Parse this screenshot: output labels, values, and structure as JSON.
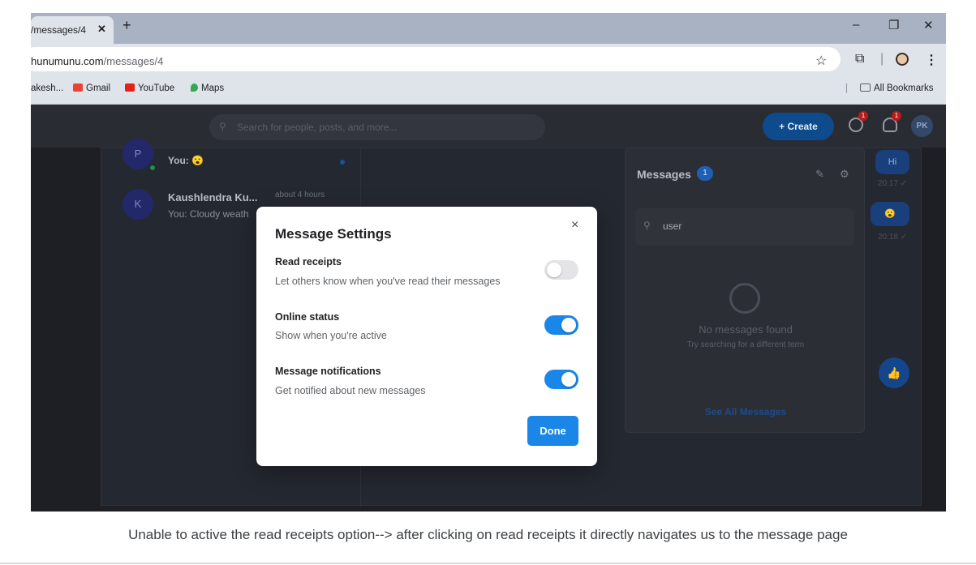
{
  "browser": {
    "tab_title": "/messages/4",
    "tab_close": "✕",
    "new_tab": "+",
    "window": {
      "minimize": "–",
      "restore": "❐",
      "close": "✕"
    },
    "url_host": "hunumunu.com",
    "url_path": "/messages/4",
    "bookmarks": [
      {
        "label": "akesh...",
        "icon": "none"
      },
      {
        "label": "Gmail",
        "icon": "gmail-icon"
      },
      {
        "label": "YouTube",
        "icon": "youtube-icon"
      },
      {
        "label": "Maps",
        "icon": "maps-icon"
      }
    ],
    "all_bookmarks": "All Bookmarks"
  },
  "app": {
    "search_placeholder": "Search for people, posts, and more...",
    "create_label": "+ Create",
    "messages_badge": "1",
    "notifications_badge": "1",
    "user_initials": "PK",
    "conversations": [
      {
        "initial": "P",
        "name": "",
        "preview": "You: 😮",
        "time": "",
        "unread": true,
        "online": true
      },
      {
        "initial": "K",
        "name": "Kaushlendra Ku...",
        "preview": "You: Cloudy weath",
        "time": "about 4 hours",
        "unread": false,
        "online": false
      }
    ],
    "messages_dropdown": {
      "title": "Messages",
      "count": "1",
      "search_value": "user",
      "empty_title": "No messages found",
      "empty_subtitle": "Try searching for a different term",
      "see_all": "See All Messages"
    },
    "chat_bubbles": [
      {
        "text": "Hi",
        "time": "20:17 ✓"
      },
      {
        "text": "😮",
        "time": "20:18 ✓"
      }
    ]
  },
  "modal": {
    "title": "Message Settings",
    "close": "×",
    "options": [
      {
        "label": "Read receipts",
        "description": "Let others know when you've read their messages",
        "enabled": false
      },
      {
        "label": "Online status",
        "description": "Show when you're active",
        "enabled": true
      },
      {
        "label": "Message notifications",
        "description": "Get notified about new messages",
        "enabled": true
      }
    ],
    "done_label": "Done"
  },
  "caption": "Unable to active the read receipts option--> after clicking on read receipts it directly navigates us to the message page"
}
